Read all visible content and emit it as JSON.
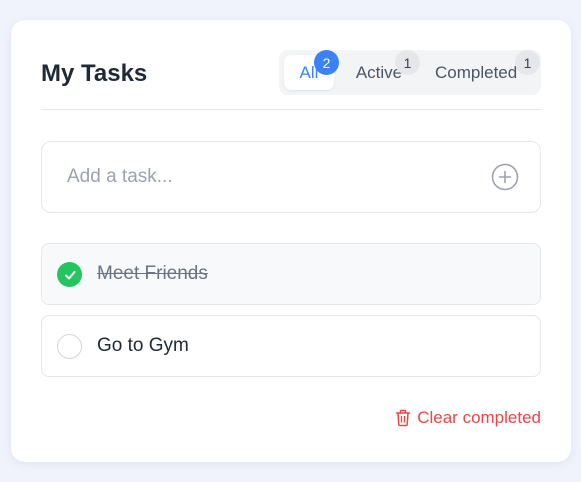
{
  "header": {
    "title": "My Tasks"
  },
  "tabs": [
    {
      "label": "All",
      "count": "2",
      "active": true
    },
    {
      "label": "Active",
      "count": "1",
      "active": false
    },
    {
      "label": "Completed",
      "count": "1",
      "active": false
    }
  ],
  "add_task": {
    "placeholder": "Add a task...",
    "icon": "plus-circle-icon"
  },
  "tasks": [
    {
      "text": "Meet Friends",
      "completed": true
    },
    {
      "text": "Go to Gym",
      "completed": false
    }
  ],
  "footer": {
    "clear_label": "Clear completed",
    "icon": "trash-icon"
  },
  "colors": {
    "accent": "#3b82f6",
    "success": "#22c55e",
    "danger": "#ef4444",
    "background": "#f1f3fc"
  }
}
